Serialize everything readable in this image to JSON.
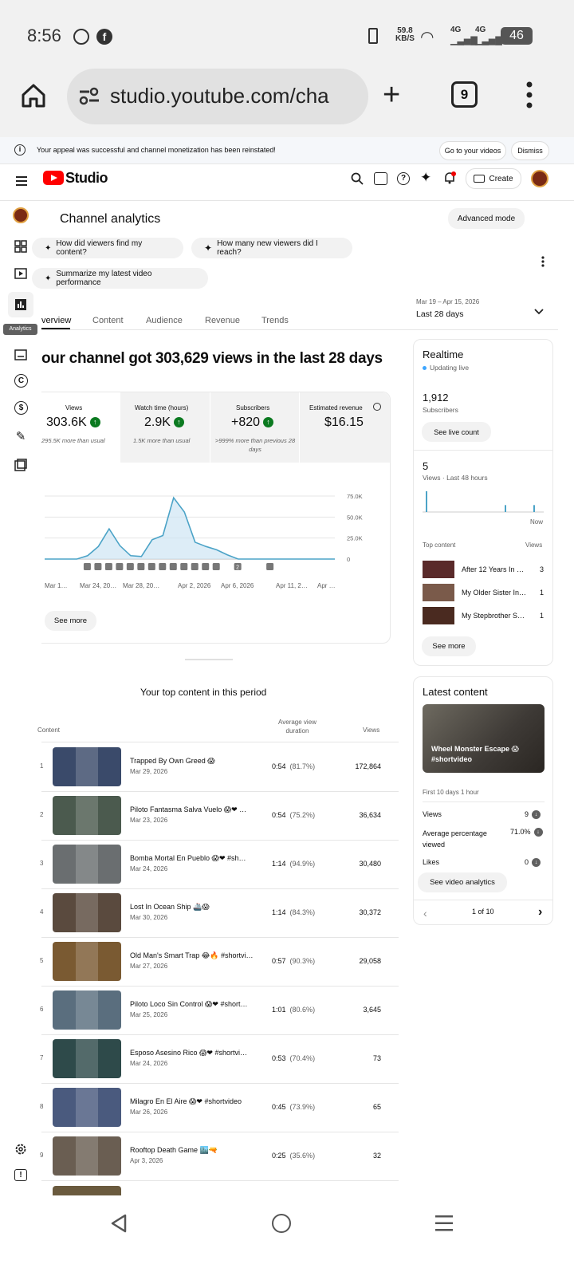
{
  "status": {
    "time": "8:56",
    "net_speed": "59.8",
    "net_unit": "KB/S",
    "sig1": "4G",
    "sig2": "4G",
    "battery": "46"
  },
  "browser": {
    "url": "studio.youtube.com/cha",
    "tab_count": "9"
  },
  "banner": {
    "text": "Your appeal was successful and channel monetization has been reinstated!",
    "go_button": "Go to your videos",
    "dismiss_button": "Dismiss"
  },
  "header": {
    "brand": "Studio",
    "create_label": "Create"
  },
  "sidebar": {
    "tooltip": "Analytics"
  },
  "page": {
    "title": "Channel analytics",
    "advanced_mode": "Advanced mode"
  },
  "chips": [
    "How did viewers find my content?",
    "How many new viewers did I reach?",
    "Summarize my latest video performance"
  ],
  "tabs": [
    "verview",
    "Content",
    "Audience",
    "Revenue",
    "Trends"
  ],
  "date_range": {
    "dates": "Mar 19 – Apr 15, 2026",
    "label": "Last 28 days"
  },
  "headline": "our channel got 303,629 views in the last 28 days",
  "metrics": [
    {
      "label": "Views",
      "value": "303.6K",
      "note": "295.5K more than usual"
    },
    {
      "label": "Watch time (hours)",
      "value": "2.9K",
      "note": "1.5K more than usual"
    },
    {
      "label": "Subscribers",
      "value": "+820",
      "note": ">999% more than previous 28 days"
    },
    {
      "label": "Estimated revenue",
      "value": "$16.15",
      "note": ""
    }
  ],
  "chart_data": {
    "type": "area",
    "x": [
      "Mar 19",
      "Mar 20",
      "Mar 21",
      "Mar 22",
      "Mar 23",
      "Mar 24",
      "Mar 25",
      "Mar 26",
      "Mar 27",
      "Mar 28",
      "Mar 29",
      "Mar 30",
      "Mar 31",
      "Apr 1",
      "Apr 2",
      "Apr 3",
      "Apr 4",
      "Apr 5",
      "Apr 6",
      "Apr 7",
      "Apr 8",
      "Apr 9",
      "Apr 10",
      "Apr 11",
      "Apr 12",
      "Apr 13",
      "Apr 14",
      "Apr 15"
    ],
    "values": [
      0,
      0,
      0,
      0,
      4000,
      15000,
      36000,
      16000,
      4000,
      3000,
      23000,
      28000,
      73000,
      56000,
      20000,
      15000,
      11000,
      5000,
      0,
      0,
      0,
      0,
      0,
      0,
      0,
      0,
      0,
      0
    ],
    "y_ticks": [
      "75.0K",
      "50.0K",
      "25.0K",
      "0"
    ],
    "ylim": [
      0,
      80000
    ],
    "x_tick_labels": [
      "Mar 1…",
      "Mar 24, 20…",
      "Mar 28, 20…",
      "Apr 2, 2026",
      "Apr 6, 2026",
      "Apr 11, 2…",
      "Apr …"
    ],
    "marker_badge": "2"
  },
  "see_more": "See more",
  "realtime": {
    "title": "Realtime",
    "status": "Updating live",
    "subs_value": "1,912",
    "subs_label": "Subscribers",
    "live_button": "See live count",
    "views_value": "5",
    "views_label": "Views · Last 48 hours",
    "now_label": "Now",
    "bars": [
      {
        "views": 3
      },
      {
        "views": 1
      },
      {
        "views": 1
      }
    ],
    "top_content_header": "Top content",
    "views_header": "Views",
    "top": [
      {
        "title": "After 12 Years In …",
        "views": "3"
      },
      {
        "title": "My Older Sister In…",
        "views": "1"
      },
      {
        "title": "My Stepbrother S…",
        "views": "1"
      }
    ],
    "see_more": "See more"
  },
  "latest": {
    "title": "Latest content",
    "video_title": "Wheel Monster Escape 😱 #shortvideo",
    "period": "First 10 days 1 hour",
    "stats": [
      {
        "label": "Views",
        "value": "9"
      },
      {
        "label": "Average percentage viewed",
        "value": "71.0%"
      },
      {
        "label": "Likes",
        "value": "0"
      }
    ],
    "analytics_button": "See video analytics",
    "pager": "1 of 10"
  },
  "top_content": {
    "heading": "Your top content in this period",
    "col_content": "Content",
    "col_avd": "Average view duration",
    "col_views": "Views",
    "rows": [
      {
        "rank": "1",
        "title": "Trapped By Own Greed 😱",
        "date": "Mar 29, 2026",
        "avd": "0:54",
        "pct": "(81.7%)",
        "views": "172,864",
        "color": "#3a4a6a"
      },
      {
        "rank": "2",
        "title": "Piloto Fantasma Salva Vuelo 😱❤ …",
        "date": "Mar 23, 2026",
        "avd": "0:54",
        "pct": "(75.2%)",
        "views": "36,634",
        "color": "#4b5a4e"
      },
      {
        "rank": "3",
        "title": "Bomba Mortal En Pueblo 😱❤ #sh…",
        "date": "Mar 24, 2026",
        "avd": "1:14",
        "pct": "(94.9%)",
        "views": "30,480",
        "color": "#6a6e70"
      },
      {
        "rank": "4",
        "title": "Lost In Ocean Ship 🚢😱",
        "date": "Mar 30, 2026",
        "avd": "1:14",
        "pct": "(84.3%)",
        "views": "30,372",
        "color": "#5a4a3e"
      },
      {
        "rank": "5",
        "title": "Old Man's Smart Trap 😂🔥 #shortvi…",
        "date": "Mar 27, 2026",
        "avd": "0:57",
        "pct": "(90.3%)",
        "views": "29,058",
        "color": "#7a5a32"
      },
      {
        "rank": "6",
        "title": "Piloto Loco Sin Control 😱❤ #short…",
        "date": "Mar 25, 2026",
        "avd": "1:01",
        "pct": "(80.6%)",
        "views": "3,645",
        "color": "#5a6e7e"
      },
      {
        "rank": "7",
        "title": "Esposo Asesino Rico 😱❤ #shortvi…",
        "date": "Mar 24, 2026",
        "avd": "0:53",
        "pct": "(70.4%)",
        "views": "73",
        "color": "#2e4a4a"
      },
      {
        "rank": "8",
        "title": "Milagro En El Aire 😱❤ #shortvideo",
        "date": "Mar 26, 2026",
        "avd": "0:45",
        "pct": "(73.9%)",
        "views": "65",
        "color": "#4a5a7e"
      },
      {
        "rank": "9",
        "title": "Rooftop Death Game 🏙️🔫",
        "date": "Apr 3, 2026",
        "avd": "0:25",
        "pct": "(35.6%)",
        "views": "32",
        "color": "#6a5e52"
      }
    ]
  }
}
